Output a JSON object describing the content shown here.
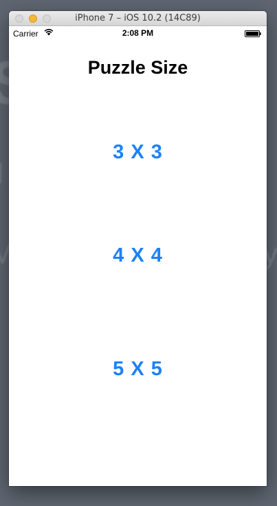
{
  "window": {
    "title": "iPhone 7 – iOS 10.2 (14C89)"
  },
  "status_bar": {
    "carrier": "Carrier",
    "time": "2:08 PM"
  },
  "screen": {
    "title": "Puzzle Size",
    "size_options": [
      {
        "label": "3 X 3"
      },
      {
        "label": "4 X 4"
      },
      {
        "label": "5 X 5"
      }
    ]
  },
  "colors": {
    "accent": "#1a82f7",
    "background": "#5f6671"
  }
}
